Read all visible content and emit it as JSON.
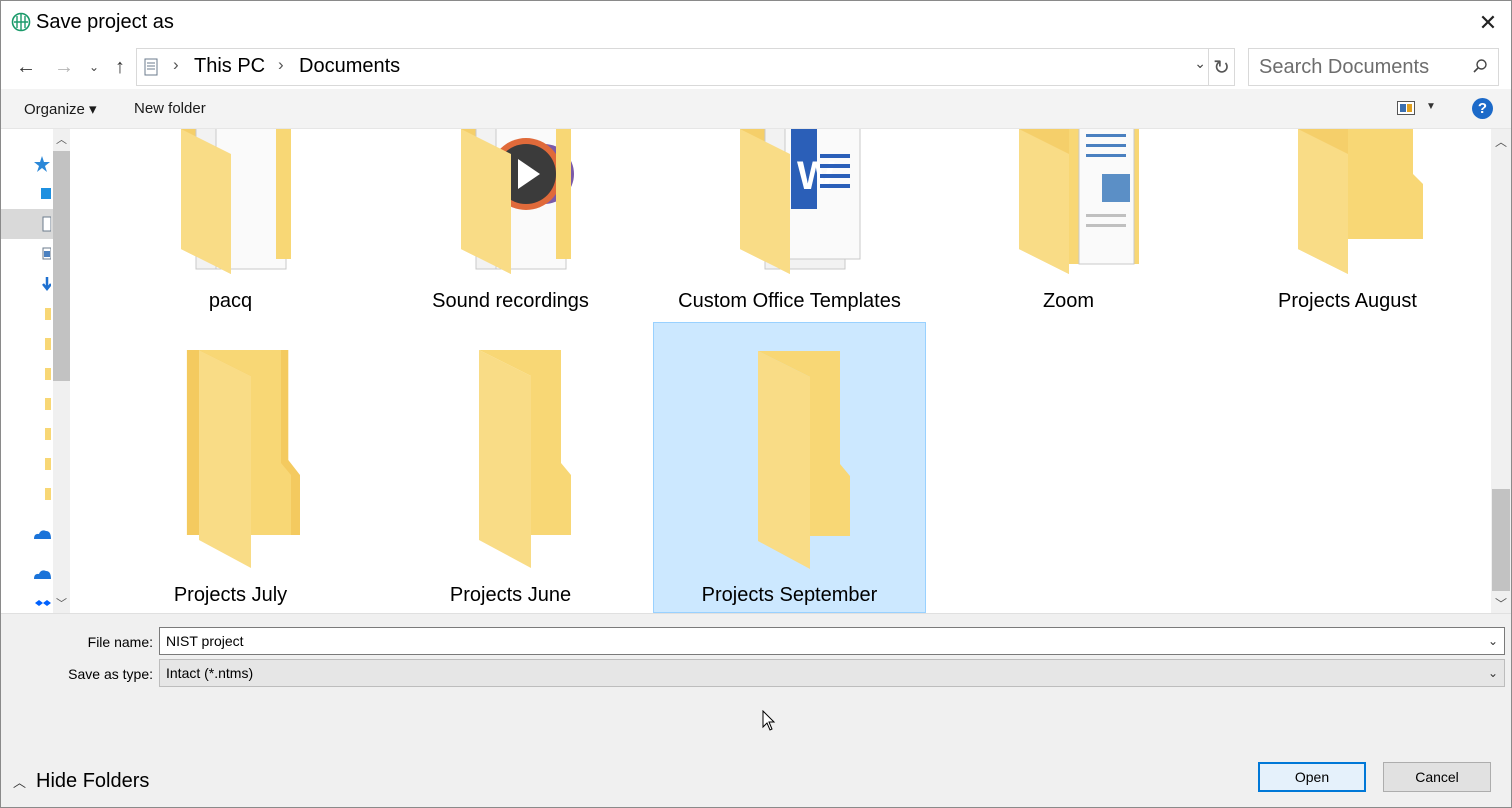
{
  "window": {
    "title": "Save project as",
    "close_glyph": "✕"
  },
  "nav": {
    "back_glyph": "←",
    "forward_glyph": "→",
    "recent_glyph": "⌄",
    "up_glyph": "↑"
  },
  "address": {
    "crumbs": [
      "This PC",
      "Documents"
    ],
    "separator": "›",
    "dropdown_glyph": "⌄",
    "refresh_glyph": "↻"
  },
  "search": {
    "placeholder": "Search Documents"
  },
  "toolbar": {
    "organize_label": "Organize ▾",
    "new_folder_label": "New folder",
    "help_label": "?"
  },
  "folders": [
    {
      "name": "pacq",
      "icon": "folder-with-documents-icon"
    },
    {
      "name": "Sound recordings",
      "icon": "folder-with-media-icon"
    },
    {
      "name": "Custom Office Templates",
      "icon": "folder-with-word-doc-icon"
    },
    {
      "name": "Zoom",
      "icon": "folder-with-documents-icon"
    },
    {
      "name": "Projects August",
      "icon": "folder-icon"
    },
    {
      "name": "Projects July",
      "icon": "folder-icon"
    },
    {
      "name": "Projects June",
      "icon": "folder-icon"
    },
    {
      "name": "Projects September",
      "icon": "folder-icon",
      "selected": true
    }
  ],
  "form": {
    "file_name_label": "File name:",
    "file_name_value": "NIST project",
    "save_as_type_label": "Save as type:",
    "save_as_type_value": "Intact (*.ntms)"
  },
  "footer": {
    "hide_folders_label": "Hide Folders",
    "open_label": "Open",
    "cancel_label": "Cancel"
  },
  "colors": {
    "accent": "#0078d7",
    "selection": "#cce8ff",
    "folder": "#f8d775"
  }
}
